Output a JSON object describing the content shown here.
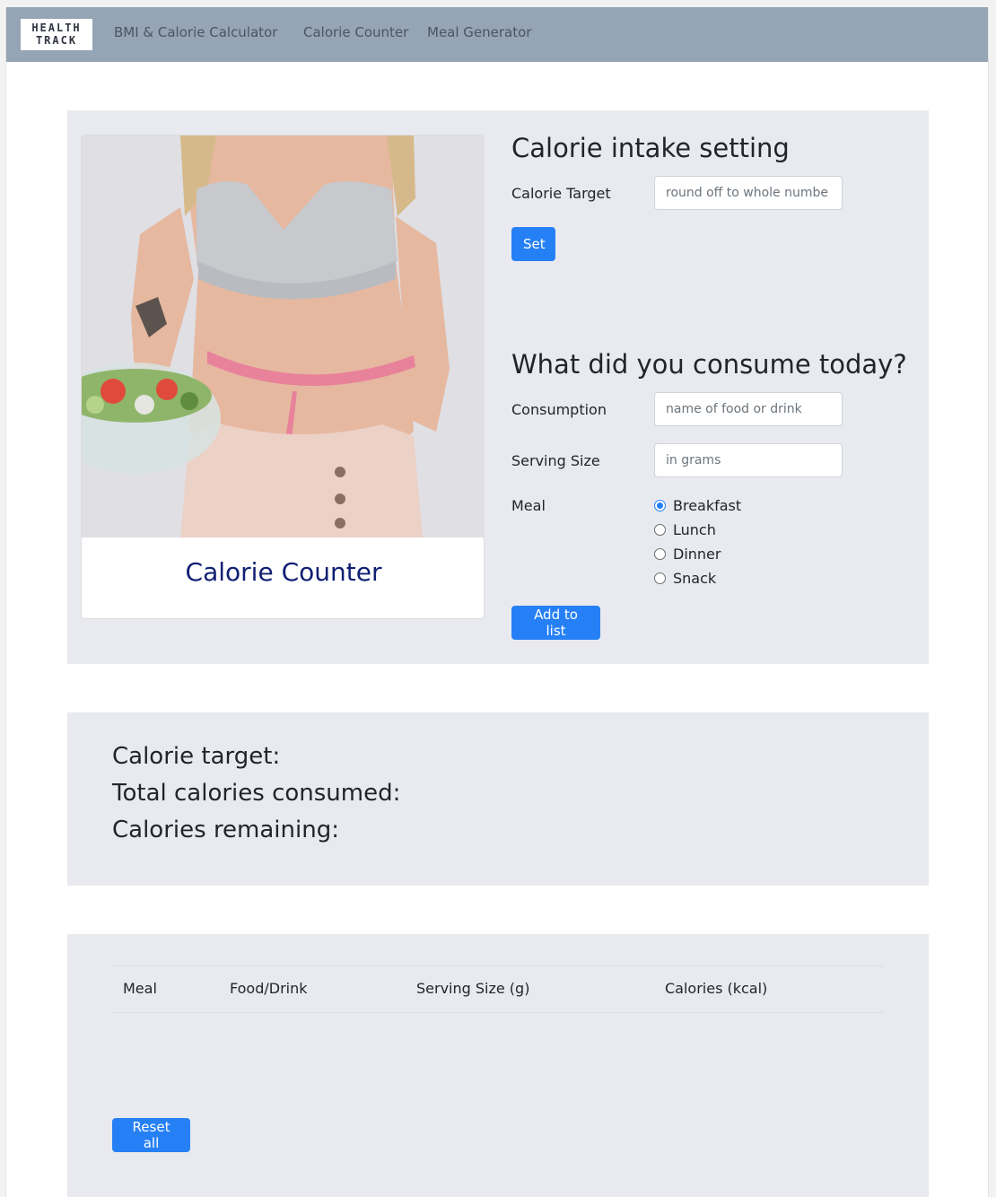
{
  "nav": {
    "logo_line1": "HEALTH",
    "logo_line2": "TRACK",
    "links": [
      "BMI & Calorie Calculator",
      "Calorie Counter",
      "Meal Generator"
    ]
  },
  "hero_card": {
    "title": "Calorie Counter",
    "image": "woman-with-salad-and-measuring-tape-photo"
  },
  "intake_setting": {
    "heading": "Calorie intake setting",
    "target_label": "Calorie Target",
    "target_value": "",
    "target_placeholder": "round off to whole numbe",
    "set_button": "Set"
  },
  "consumption": {
    "heading": "What did you consume today?",
    "consumption_label": "Consumption",
    "consumption_value": "",
    "consumption_placeholder": "name of food or drink",
    "serving_label": "Serving Size",
    "serving_value": "",
    "serving_placeholder": "in grams",
    "meal_label": "Meal",
    "meal_options": [
      "Breakfast",
      "Lunch",
      "Dinner",
      "Snack"
    ],
    "meal_selected": "Breakfast",
    "add_button": "Add to list"
  },
  "summary": {
    "calorie_target": "Calorie target:",
    "total_consumed": "Total calories consumed:",
    "remaining": "Calories remaining:"
  },
  "log_table": {
    "columns": [
      "Meal",
      "Food/Drink",
      "Serving Size (g)",
      "Calories (kcal)"
    ],
    "rows": []
  },
  "reset_button": "Reset all",
  "colors": {
    "navbar": "#95a5b5",
    "panel": "#e9eaef",
    "primary_button": "#2680f5",
    "card_title": "#0f1f73"
  }
}
